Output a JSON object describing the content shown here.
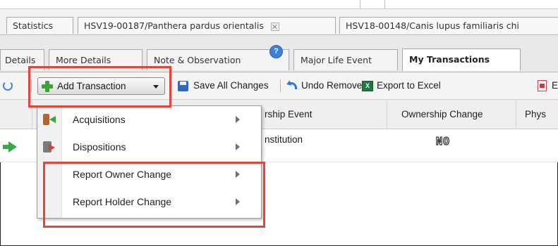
{
  "main_tabs": [
    {
      "label": "Statistics",
      "closable": false
    },
    {
      "label": "HSV19-00187/Panthera pardus orientalis",
      "closable": true
    },
    {
      "label": "HSV18-00148/Canis lupus familiaris chi",
      "closable": false
    }
  ],
  "sub_tabs": [
    {
      "label": "Details",
      "active": false
    },
    {
      "label": "More Details",
      "active": false
    },
    {
      "label": "Note & Observation",
      "active": false,
      "help_badge": "?"
    },
    {
      "label": "Major Life Event",
      "active": false
    },
    {
      "label": "My Transactions",
      "active": true
    }
  ],
  "toolbar": {
    "add_transaction_label": "Add Transaction",
    "save_all_label": "Save All Changes",
    "undo_remove_label": "Undo Remove",
    "export_excel_label": "Export to Excel",
    "export_excel_badge": "X",
    "pdf_initial": "E"
  },
  "grid": {
    "headers": {
      "ownership_event": "rship Event",
      "ownership_change": "Ownership Change",
      "physical": "Phys"
    },
    "rows": [
      {
        "ownership_event": "nstitution",
        "ownership_change": "NO"
      }
    ]
  },
  "menu": {
    "items": [
      {
        "label": "Acquisitions",
        "icon": "acquisitions-icon",
        "has_submenu": true
      },
      {
        "label": "Dispositions",
        "icon": "dispositions-icon",
        "has_submenu": true
      },
      {
        "label": "Report Owner Change",
        "icon": "",
        "has_submenu": true
      },
      {
        "label": "Report Holder Change",
        "icon": "",
        "has_submenu": true
      }
    ]
  },
  "colors": {
    "highlight": "#e2453d",
    "add_icon_green": "#3aa33a",
    "active_tab_bg": "#ffffff"
  }
}
